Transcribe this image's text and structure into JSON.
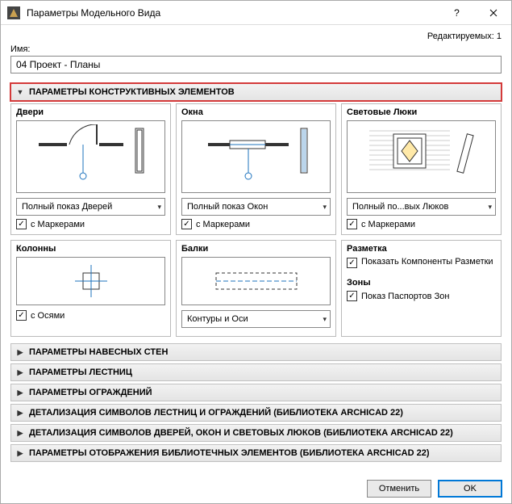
{
  "window": {
    "title": "Параметры Модельного Вида",
    "editable_count_label": "Редактируемых: 1"
  },
  "name": {
    "label": "Имя:",
    "value": "04 Проект - Планы"
  },
  "sections": {
    "construct": {
      "title": "ПАРАМЕТРЫ КОНСТРУКТИВНЫХ ЭЛЕМЕНТОВ",
      "doors": {
        "title": "Двери",
        "combo": "Полный показ Дверей",
        "markers": "с Маркерами"
      },
      "windows": {
        "title": "Окна",
        "combo": "Полный показ Окон",
        "markers": "с Маркерами"
      },
      "skylights": {
        "title": "Световые Люки",
        "combo": "Полный по...вых Люков",
        "markers": "с Маркерами"
      },
      "columns": {
        "title": "Колонны",
        "axes": "с Осями"
      },
      "beams": {
        "title": "Балки",
        "combo": "Контуры и Оси"
      },
      "markup": {
        "title": "Разметка",
        "show_components": "Показать Компоненты Разметки",
        "zones_title": "Зоны",
        "zone_passports": "Показ Паспортов Зон"
      }
    },
    "collapsed": [
      "ПАРАМЕТРЫ НАВЕСНЫХ СТЕН",
      "ПАРАМЕТРЫ ЛЕСТНИЦ",
      "ПАРАМЕТРЫ ОГРАЖДЕНИЙ",
      "ДЕТАЛИЗАЦИЯ СИМВОЛОВ ЛЕСТНИЦ И ОГРАЖДЕНИЙ (БИБЛИОТЕКА ARCHICAD 22)",
      "ДЕТАЛИЗАЦИЯ СИМВОЛОВ ДВЕРЕЙ, ОКОН И СВЕТОВЫХ ЛЮКОВ (БИБЛИОТЕКА ARCHICAD 22)",
      "ПАРАМЕТРЫ ОТОБРАЖЕНИЯ БИБЛИОТЕЧНЫХ ЭЛЕМЕНТОВ (БИБЛИОТЕКА ARCHICAD 22)"
    ]
  },
  "buttons": {
    "cancel": "Отменить",
    "ok": "OK"
  }
}
